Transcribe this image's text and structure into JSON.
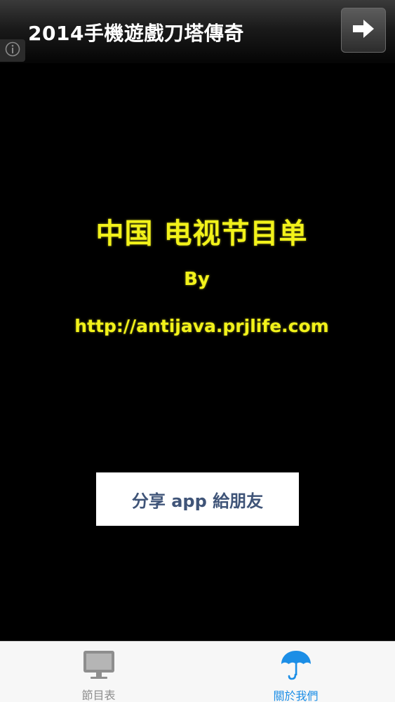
{
  "ad": {
    "title": "2014手機遊戲刀塔傳奇",
    "arrow_icon": "arrow-right-icon",
    "info_icon": "info-icon"
  },
  "credits": {
    "title": "中国 电视节目单",
    "by": "By",
    "url": "http://antijava.prjlife.com",
    "text_color": "#f2f21a"
  },
  "share_button": {
    "label": "分享 app 給朋友",
    "text_color": "#3f5478"
  },
  "tab_bar": {
    "tabs": [
      {
        "label": "節目表",
        "icon": "monitor-icon",
        "active": false,
        "color": "#8e8e8e"
      },
      {
        "label": "關於我們",
        "icon": "umbrella-icon",
        "active": true,
        "color": "#1c8ee6"
      }
    ]
  },
  "colors": {
    "background": "#000000",
    "tab_bar_background": "#f7f7f7",
    "accent": "#1c8ee6"
  }
}
